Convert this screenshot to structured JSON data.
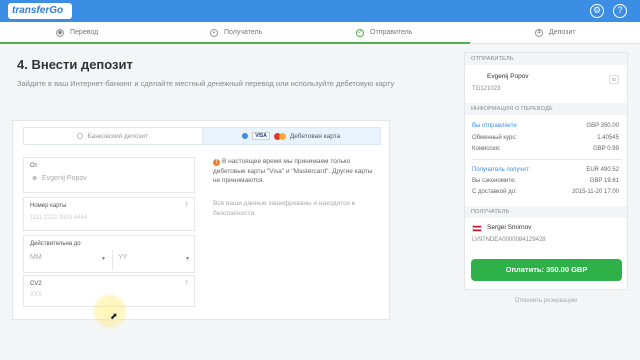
{
  "header": {
    "logo": "transferGo",
    "icons": [
      "gear-icon",
      "help-icon"
    ],
    "accent": "#3c8ee4"
  },
  "steps": [
    {
      "label": "Перевод",
      "icon": "globe-icon",
      "active": false
    },
    {
      "label": "Получатель",
      "icon": "lock-icon",
      "active": false
    },
    {
      "label": "Отправитель",
      "icon": "check-icon",
      "active": true
    },
    {
      "label": "Депозит",
      "number": "4",
      "active": false
    }
  ],
  "main": {
    "title": "4. Внести депозит",
    "subtitle": "Зайдите в ваш Интернет-банкинг и сделайте местный денежный перевод или используйте дебетовую карту",
    "tabs": [
      {
        "label": "Банковский депозит"
      },
      {
        "label": "Дебетовая карта",
        "card_brands": [
          "VISA",
          "mastercard"
        ]
      }
    ],
    "form": {
      "from_label": "От",
      "from_value": "Evgenij Popov",
      "card_number_label": "Номер карты",
      "card_number_placeholder": "1111 2222 3333 4444",
      "card_number_help": "?",
      "valid_until_label": "Действительна до",
      "month_placeholder": "MM",
      "year_placeholder": "YY",
      "cvv_label": "CV2",
      "cvv_placeholder": "XXX",
      "cvv_help": "?"
    },
    "notice": "В настоящее время мы принимаем только дебетовые карты \"Visa\" и \"Mastercard\". Другие карты не принимаются.",
    "secure_note": "Все ваши данные зашифрованы и находится в безопасности."
  },
  "sidebar": {
    "sender_header": "ОТПРАВИТЕЛЬ",
    "sender_name": "Evgenij Popov",
    "sender_id": "TG121023",
    "id_badge": "ID",
    "transfer_header": "ИНФОРМАЦИЯ О ПЕРЕВОДЕ",
    "rows": [
      {
        "label": "Вы отправляете",
        "value": "GBP 350.00",
        "highlight": true
      },
      {
        "label": "Обменный курс:",
        "value": "1.40545",
        "highlight": false
      },
      {
        "label": "Комиссия:",
        "value": "GBP 0.99",
        "highlight": false
      }
    ],
    "rows2": [
      {
        "label": "Получатель получит:",
        "value": "EUR 490.52",
        "highlight": true
      },
      {
        "label": "Вы сэкономите:",
        "value": "GBP 19.61",
        "highlight": false
      },
      {
        "label": "С доставкой до:",
        "value": "2015-11-20 17:00",
        "highlight": false
      }
    ],
    "recipient_header": "ПОЛУЧАТЕЛЬ",
    "recipient_name": "Sergei Smirnov",
    "recipient_iban": "LV97NDEA0000084129428",
    "pay_button": "Оплатить: 350.00 GBP",
    "pay_color": "#2fb14a"
  },
  "cancel_link": "Отменить резервацию"
}
